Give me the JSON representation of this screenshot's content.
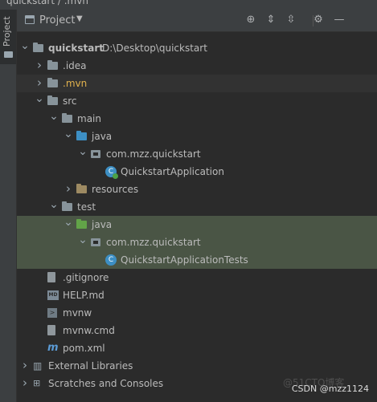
{
  "window": {
    "breadcrumb": "quickstart / .mvn"
  },
  "sidebar": {
    "tab_label": "Project"
  },
  "header": {
    "title": "Project",
    "caret": "▼"
  },
  "toolbar": {
    "locate_icon": "⊕",
    "expand_icon": "⇕",
    "collapse_icon": "⇳",
    "settings_icon": "⚙",
    "hide_icon": "—"
  },
  "tree": [
    {
      "label": "quickstart",
      "path": "D:\\Desktop\\quickstart",
      "icon": "project-folder-icon",
      "arrow": "expanded",
      "indent": 0
    },
    {
      "label": ".idea",
      "icon": "folder-icon",
      "arrow": "collapsed",
      "indent": 1
    },
    {
      "label": ".mvn",
      "icon": "folder-icon",
      "arrow": "collapsed",
      "indent": 1,
      "color": "#e0b14d",
      "selected": "dark"
    },
    {
      "label": "src",
      "icon": "folder-icon",
      "arrow": "expanded",
      "indent": 1
    },
    {
      "label": "main",
      "icon": "folder-icon",
      "arrow": "expanded",
      "indent": 2
    },
    {
      "label": "java",
      "icon": "source-folder-icon",
      "arrow": "expanded",
      "indent": 3
    },
    {
      "label": "com.mzz.quickstart",
      "icon": "package-icon",
      "arrow": "expanded",
      "indent": 4
    },
    {
      "label": "QuickstartApplication",
      "icon": "spring-class-icon",
      "arrow": "none",
      "indent": 5
    },
    {
      "label": "resources",
      "icon": "resources-folder-icon",
      "arrow": "collapsed",
      "indent": 3
    },
    {
      "label": "test",
      "icon": "folder-icon",
      "arrow": "expanded",
      "indent": 2
    },
    {
      "label": "java",
      "icon": "test-source-folder-icon",
      "arrow": "expanded",
      "indent": 3,
      "selected": "green"
    },
    {
      "label": "com.mzz.quickstart",
      "icon": "package-icon",
      "arrow": "expanded",
      "indent": 4,
      "selected": "green"
    },
    {
      "label": "QuickstartApplicationTests",
      "icon": "class-icon",
      "arrow": "none",
      "indent": 5,
      "selected": "green"
    },
    {
      "label": ".gitignore",
      "icon": "gitignore-file-icon",
      "arrow": "none",
      "indent": 1
    },
    {
      "label": "HELP.md",
      "icon": "markdown-file-icon",
      "arrow": "none",
      "indent": 1
    },
    {
      "label": "mvnw",
      "icon": "script-file-icon",
      "arrow": "none",
      "indent": 1
    },
    {
      "label": "mvnw.cmd",
      "icon": "text-file-icon",
      "arrow": "none",
      "indent": 1
    },
    {
      "label": "pom.xml",
      "icon": "maven-icon",
      "arrow": "none",
      "indent": 1
    },
    {
      "label": "External Libraries",
      "icon": "libraries-icon",
      "arrow": "collapsed",
      "indent": 0
    },
    {
      "label": "Scratches and Consoles",
      "icon": "scratches-icon",
      "arrow": "collapsed",
      "indent": 0
    }
  ],
  "watermark": {
    "faint": "@51CTO博客",
    "text": "CSDN @mzz1124"
  },
  "colors": {
    "background": "#2b2b2b",
    "toolbar": "#3c3f41",
    "selection_green": "#4a5545",
    "text": "#bbbbbb"
  }
}
